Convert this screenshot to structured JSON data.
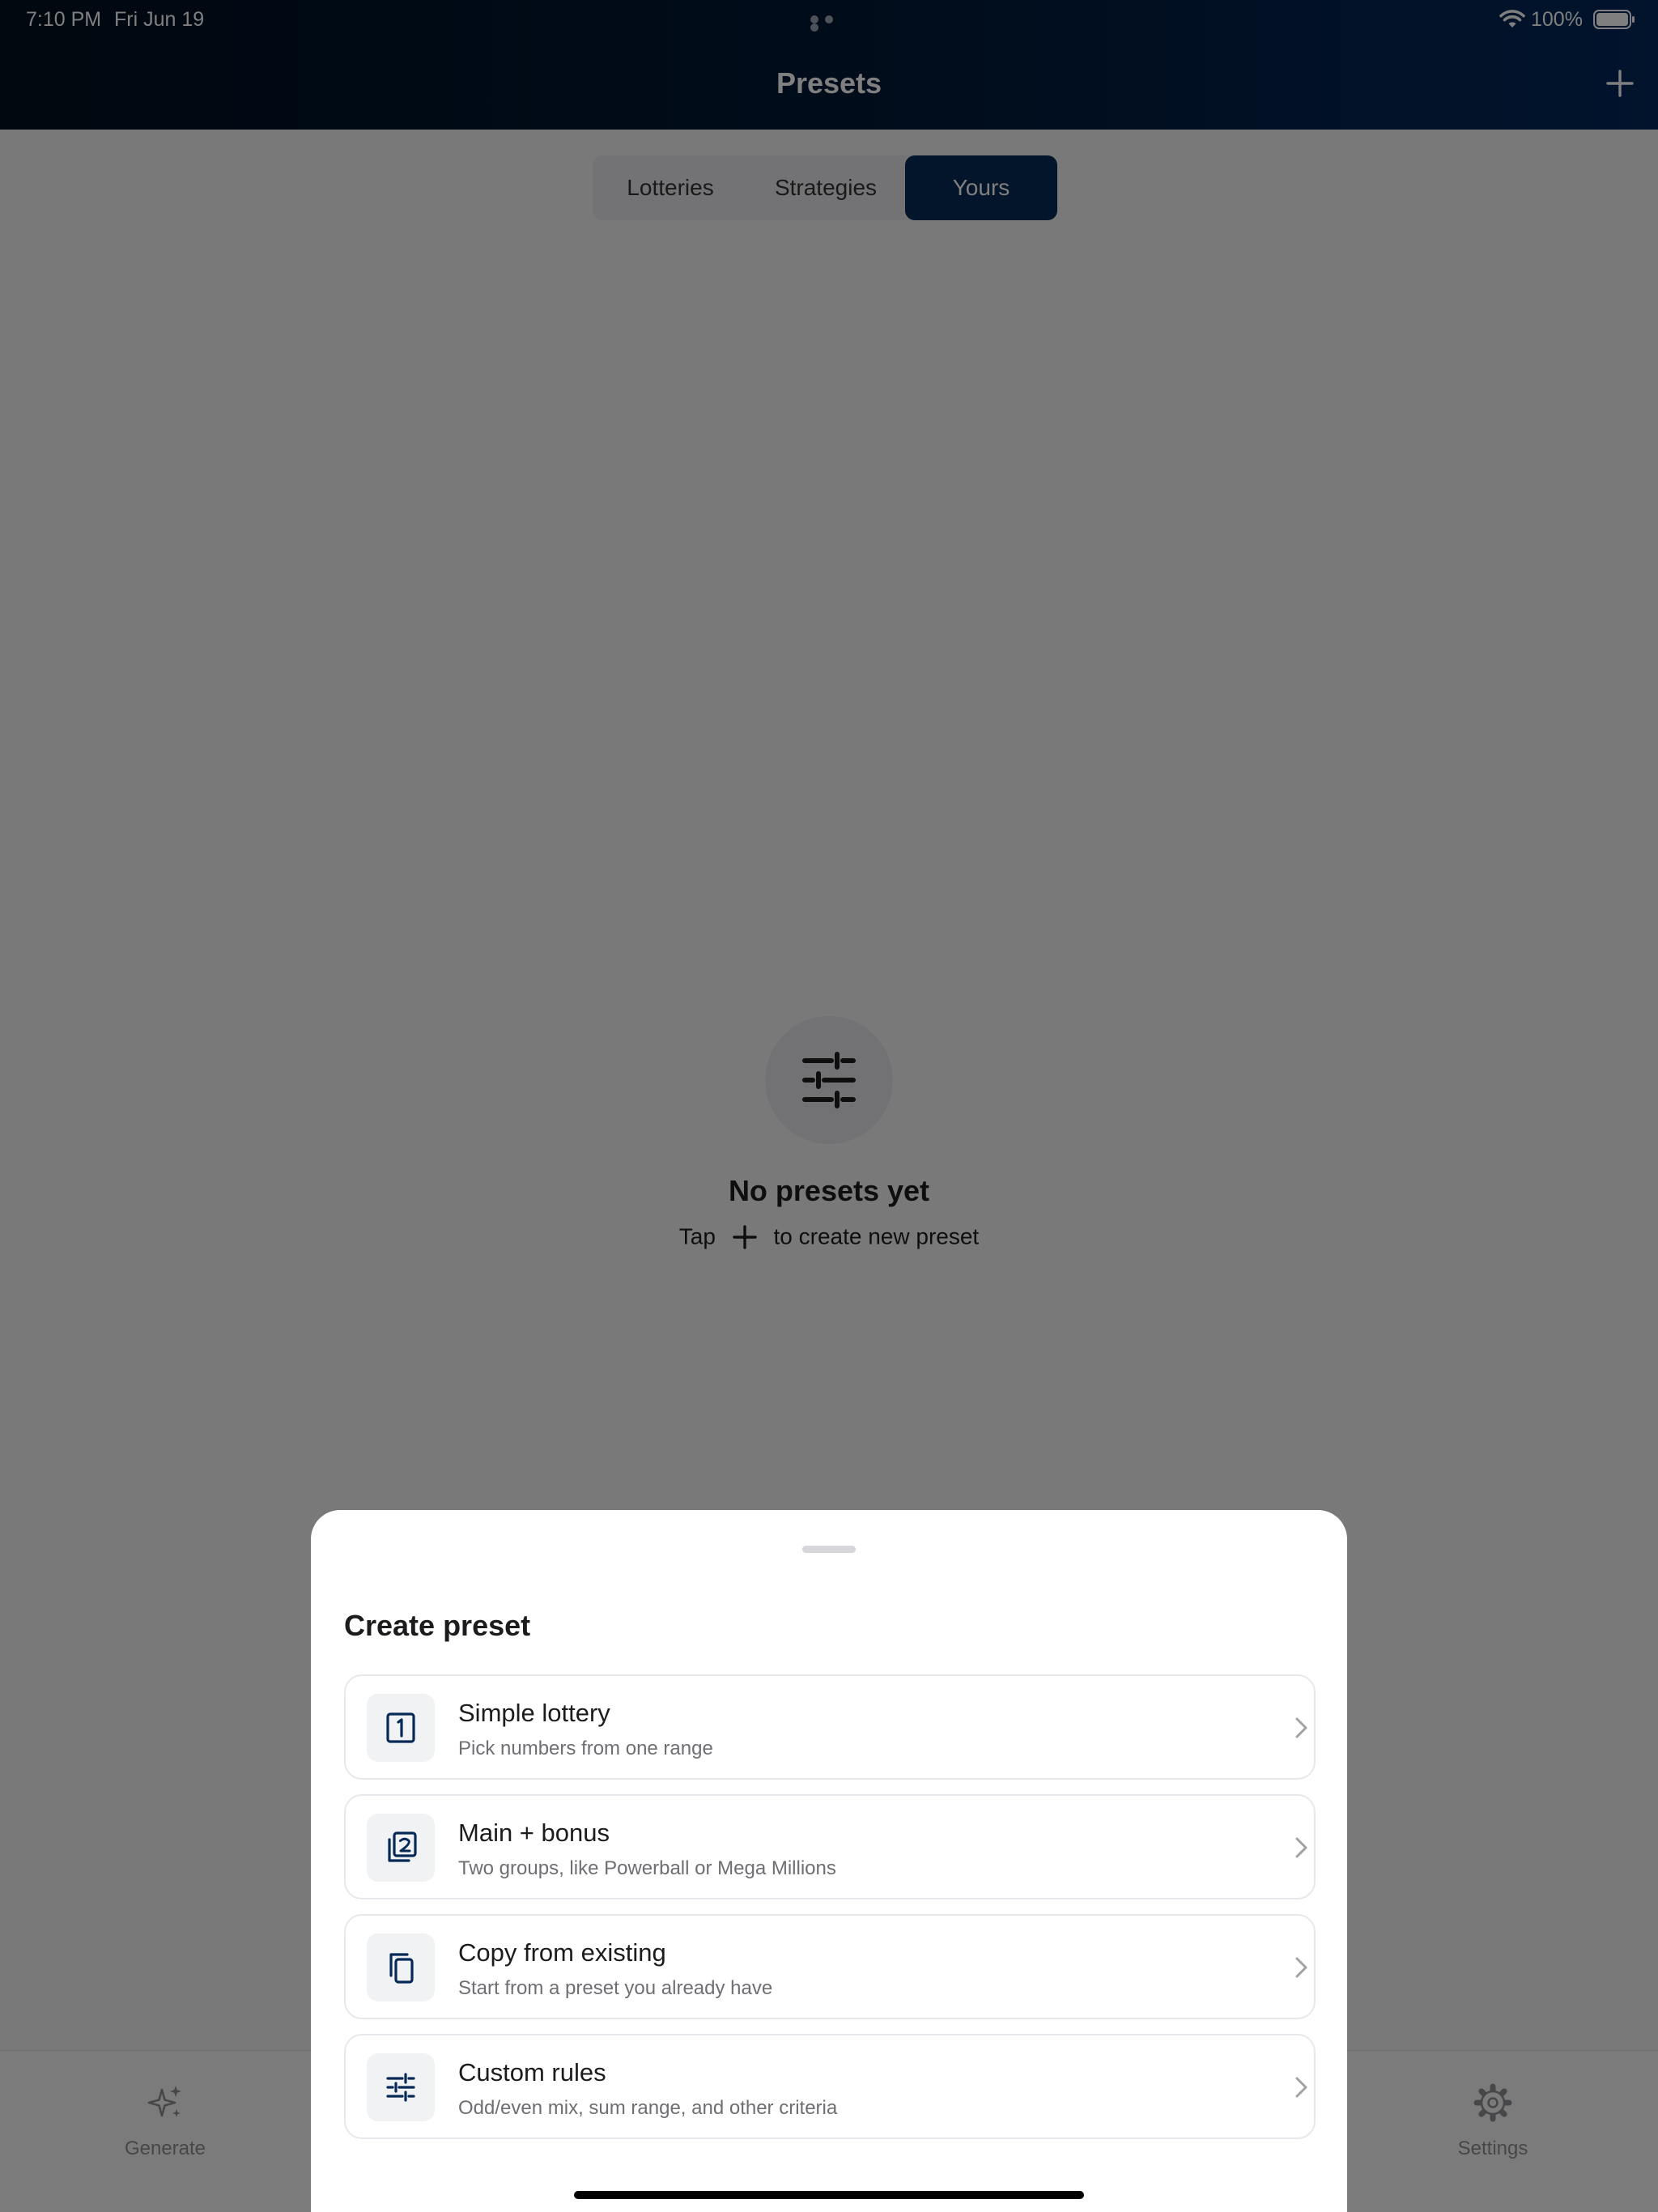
{
  "status": {
    "time": "7:10 PM",
    "date": "Fri Jun 19",
    "battery": "100%"
  },
  "nav": {
    "title": "Presets"
  },
  "segments": [
    "Lotteries",
    "Strategies",
    "Yours"
  ],
  "empty": {
    "title": "No presets yet",
    "sub_before": "Tap",
    "sub_after": "to create new preset"
  },
  "tabbar": {
    "generate": "Generate",
    "settings": "Settings"
  },
  "sheet": {
    "title": "Create preset",
    "options": [
      {
        "title": "Simple lottery",
        "subtitle": "Pick numbers from one range",
        "icon": "digit-one-icon"
      },
      {
        "title": "Main + bonus",
        "subtitle": "Two groups, like Powerball or Mega Millions",
        "icon": "stacked-two-icon"
      },
      {
        "title": "Copy from existing",
        "subtitle": "Start from a preset you already have",
        "icon": "copy-icon"
      },
      {
        "title": "Custom rules",
        "subtitle": "Odd/even mix, sum range, and other criteria",
        "icon": "sliders-icon"
      }
    ]
  },
  "colors": {
    "accent": "#062a57",
    "nav_dark": "#01101f",
    "nav_light": "#03285a"
  }
}
